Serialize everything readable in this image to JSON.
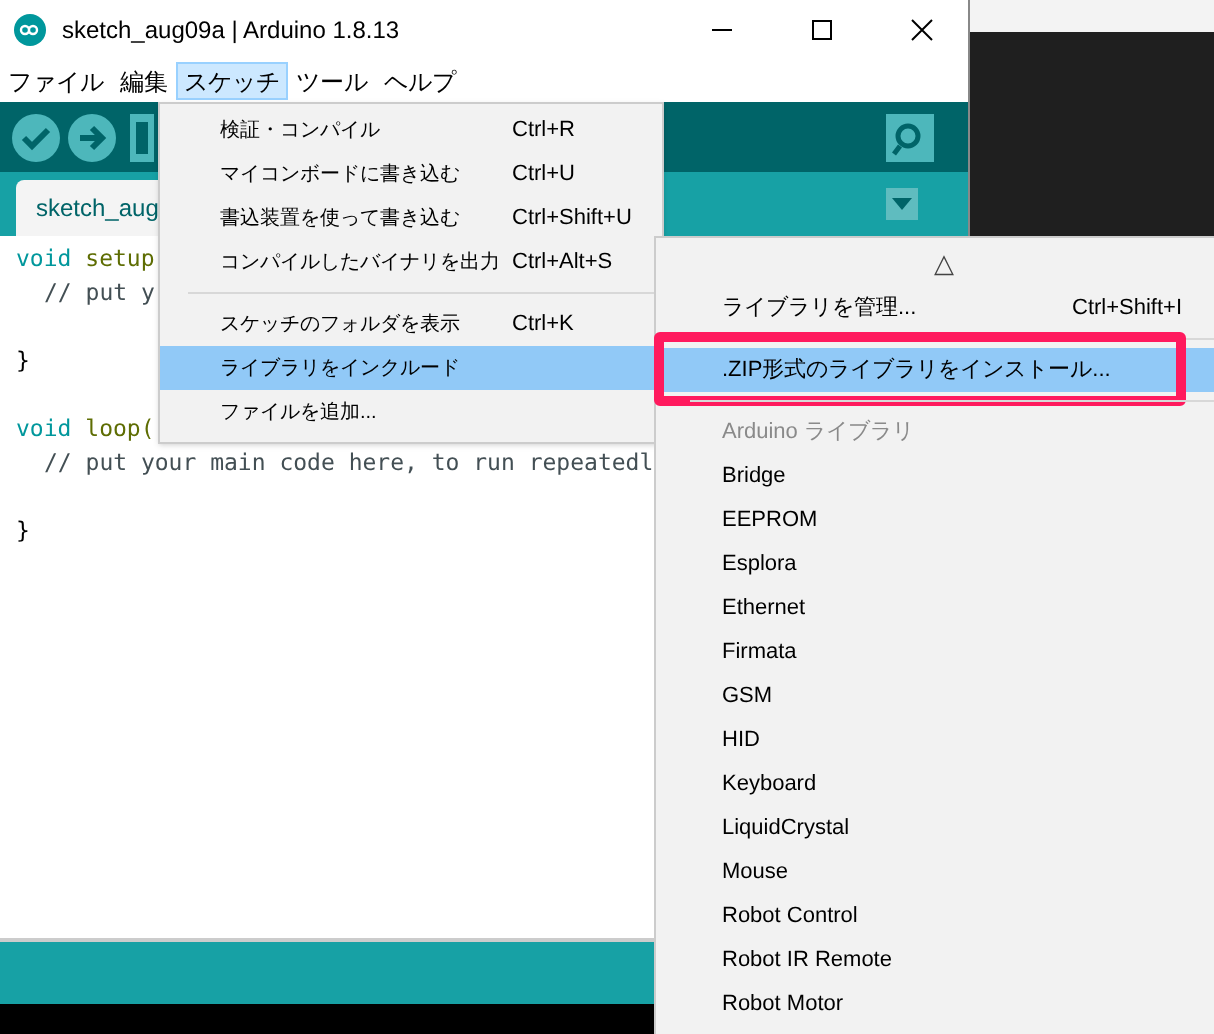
{
  "window": {
    "title": "sketch_aug09a | Arduino 1.8.13"
  },
  "menubar": [
    {
      "label": "ファイル",
      "selected": false
    },
    {
      "label": "編集",
      "selected": false
    },
    {
      "label": "スケッチ",
      "selected": true
    },
    {
      "label": "ツール",
      "selected": false
    },
    {
      "label": "ヘルプ",
      "selected": false
    }
  ],
  "tab": {
    "label": "sketch_aug"
  },
  "code": [
    {
      "kind": "fn",
      "keyword": "void",
      "name": "setup"
    },
    {
      "kind": "comment",
      "text": "// put y"
    },
    {
      "kind": "blank"
    },
    {
      "kind": "plain",
      "text": "}"
    },
    {
      "kind": "blank"
    },
    {
      "kind": "fn",
      "keyword": "void",
      "name": "loop("
    },
    {
      "kind": "comment",
      "text": "// put your main code here, to run repeatedl"
    },
    {
      "kind": "blank"
    },
    {
      "kind": "plain",
      "text": "}"
    }
  ],
  "sketch_menu": [
    {
      "kind": "item",
      "label": "検証・コンパイル",
      "shortcut": "Ctrl+R",
      "selected": false
    },
    {
      "kind": "item",
      "label": "マイコンボードに書き込む",
      "shortcut": "Ctrl+U",
      "selected": false
    },
    {
      "kind": "item",
      "label": "書込装置を使って書き込む",
      "shortcut": "Ctrl+Shift+U",
      "selected": false
    },
    {
      "kind": "item",
      "label": "コンパイルしたバイナリを出力",
      "shortcut": "Ctrl+Alt+S",
      "selected": false
    },
    {
      "kind": "separator"
    },
    {
      "kind": "item",
      "label": "スケッチのフォルダを表示",
      "shortcut": "Ctrl+K",
      "selected": false
    },
    {
      "kind": "item",
      "label": "ライブラリをインクルード",
      "selected": true
    },
    {
      "kind": "item",
      "label": "ファイルを追加...",
      "selected": false
    }
  ],
  "library_menu": [
    {
      "kind": "scroll",
      "label": "△"
    },
    {
      "kind": "item",
      "label": "ライブラリを管理...",
      "shortcut": "Ctrl+Shift+I",
      "selected": false
    },
    {
      "kind": "separator"
    },
    {
      "kind": "item",
      "label": ".ZIP形式のライブラリをインストール...",
      "selected": true,
      "outlined": true
    },
    {
      "kind": "separator"
    },
    {
      "kind": "header",
      "label": "Arduino ライブラリ"
    },
    {
      "kind": "item",
      "label": "Bridge",
      "selected": false
    },
    {
      "kind": "item",
      "label": "EEPROM",
      "selected": false
    },
    {
      "kind": "item",
      "label": "Esplora",
      "selected": false
    },
    {
      "kind": "item",
      "label": "Ethernet",
      "selected": false
    },
    {
      "kind": "item",
      "label": "Firmata",
      "selected": false
    },
    {
      "kind": "item",
      "label": "GSM",
      "selected": false
    },
    {
      "kind": "item",
      "label": "HID",
      "selected": false
    },
    {
      "kind": "item",
      "label": "Keyboard",
      "selected": false
    },
    {
      "kind": "item",
      "label": "LiquidCrystal",
      "selected": false
    },
    {
      "kind": "item",
      "label": "Mouse",
      "selected": false
    },
    {
      "kind": "item",
      "label": "Robot Control",
      "selected": false
    },
    {
      "kind": "item",
      "label": "Robot IR Remote",
      "selected": false
    },
    {
      "kind": "item",
      "label": "Robot Motor",
      "selected": false
    }
  ]
}
